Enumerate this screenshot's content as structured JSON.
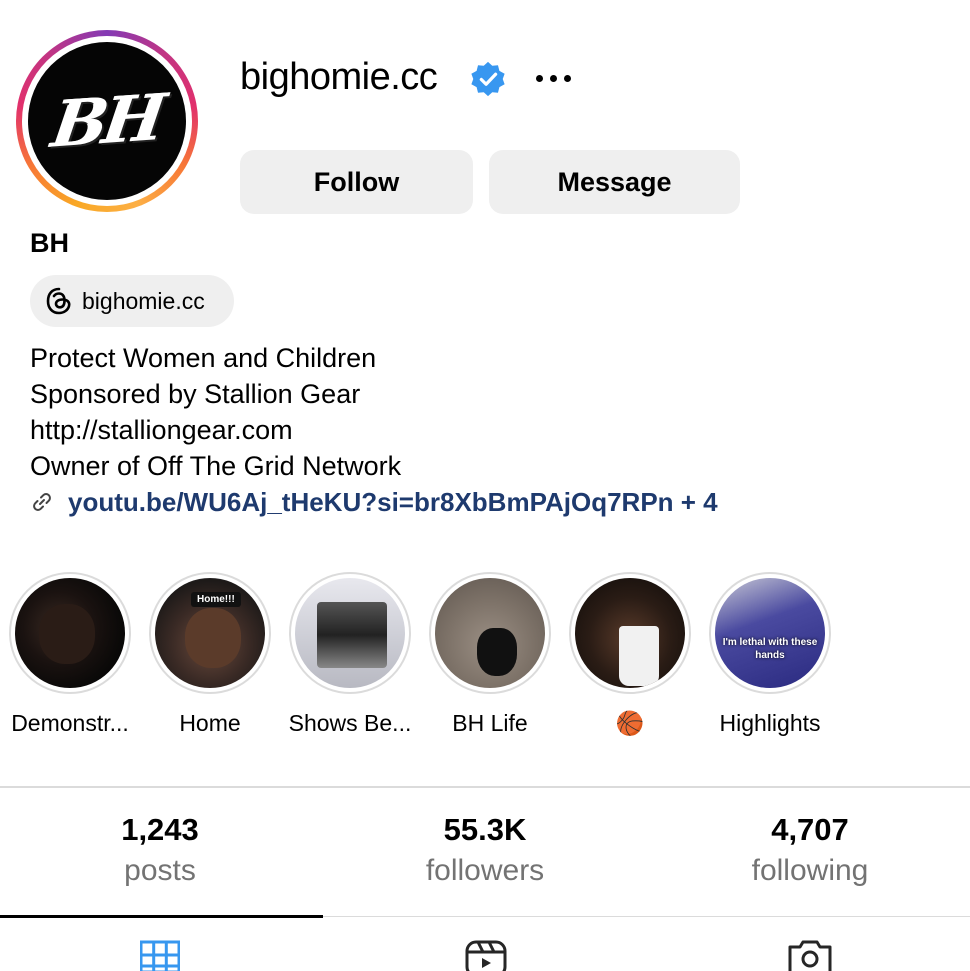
{
  "profile": {
    "username": "bighomie.cc",
    "avatar_text": "BH",
    "display_name": "BH",
    "threads_handle": "bighomie.cc",
    "bio_lines": [
      "Protect Women and Children",
      "Sponsored by Stallion Gear",
      "http://stalliongear.com",
      "Owner of Off The Grid Network"
    ],
    "link": "youtu.be/WU6Aj_tHeKU?si=br8XbBmPAjOq7RPn + 4"
  },
  "actions": {
    "follow_label": "Follow",
    "message_label": "Message"
  },
  "highlights": [
    {
      "label": "Demonstr...",
      "overlay": ""
    },
    {
      "label": "Home",
      "overlay": "Home!!!"
    },
    {
      "label": "Shows Be...",
      "overlay": ""
    },
    {
      "label": "BH Life",
      "overlay": ""
    },
    {
      "label": "🏀",
      "overlay": ""
    },
    {
      "label": "Highlights",
      "overlay": "I'm lethal with these hands"
    }
  ],
  "stats": {
    "posts": {
      "value": "1,243",
      "label": "posts"
    },
    "followers": {
      "value": "55.3K",
      "label": "followers"
    },
    "following": {
      "value": "4,707",
      "label": "following"
    }
  },
  "tabs": [
    {
      "name": "grid",
      "icon": "grid-icon",
      "active": true
    },
    {
      "name": "reels",
      "icon": "reels-icon",
      "active": false
    },
    {
      "name": "tagged",
      "icon": "tagged-icon",
      "active": false
    }
  ],
  "colors": {
    "verified": "#3897f0",
    "link": "#1e3a6e",
    "active_tab_icon": "#3797ef",
    "secondary_text": "#737373",
    "button_bg": "#efefef"
  }
}
